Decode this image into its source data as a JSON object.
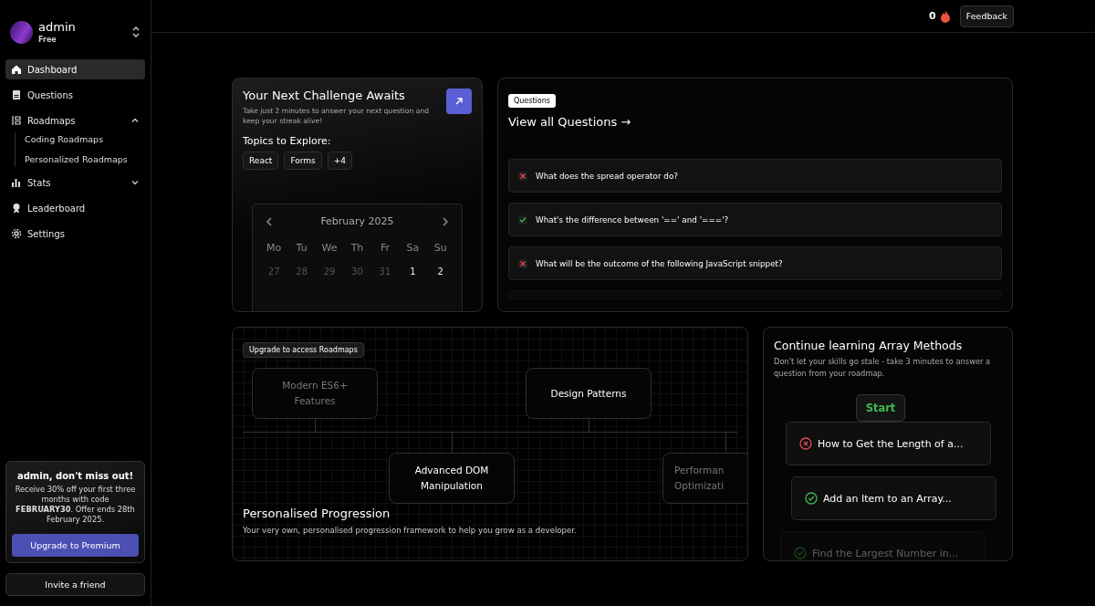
{
  "user": {
    "name": "admin",
    "plan": "Free"
  },
  "sidebar": {
    "items": [
      {
        "label": "Dashboard",
        "selected": true
      },
      {
        "label": "Questions",
        "selected": false
      },
      {
        "label": "Roadmaps",
        "selected": false,
        "expanded": true,
        "children": [
          {
            "label": "Coding Roadmaps",
            "selected": false
          },
          {
            "label": "Personalized Roadmaps",
            "selected": false
          }
        ]
      },
      {
        "label": "Stats",
        "selected": false,
        "expanded": false
      },
      {
        "label": "Leaderboard",
        "selected": false
      },
      {
        "label": "Settings",
        "selected": false
      }
    ]
  },
  "promo": {
    "title": "admin, don't miss out!",
    "text": "Receive 30% off your first three months with code **FEBRUARY30**. Offer ends 28th February 2025.",
    "button": "Upgrade to Premium"
  },
  "invite_button": "Invite a friend",
  "topbar": {
    "streak": "0",
    "feedback": "Feedback"
  },
  "challenge": {
    "title": "Your Next Challenge Awaits",
    "text": "Take just 2 minutes to answer your next question and keep your streak alive!",
    "topics_label": "Topics to Explore:",
    "topics": [
      "React",
      "Forms",
      "+4"
    ],
    "calendar": {
      "month": "February 2025",
      "weekdays": [
        "Mo",
        "Tu",
        "We",
        "Th",
        "Fr",
        "Sa",
        "Su"
      ],
      "days": [
        {
          "label": "27",
          "muted": true
        },
        {
          "label": "28",
          "muted": true
        },
        {
          "label": "29",
          "muted": true
        },
        {
          "label": "30",
          "muted": true
        },
        {
          "label": "31",
          "muted": true
        },
        {
          "label": "1",
          "muted": false
        },
        {
          "label": "2",
          "muted": false
        }
      ]
    }
  },
  "questions": {
    "badge": "Questions",
    "link": "View all Questions →",
    "items": [
      {
        "text": "What does the spread operator do?",
        "correct": false
      },
      {
        "text": "What's the difference between '==' and '==='?",
        "correct": true
      },
      {
        "text": "What will be the outcome of the following JavaScript snippet?",
        "correct": false
      }
    ]
  },
  "roadmap": {
    "badge": "Upgrade to access Roadmaps",
    "nodes": [
      {
        "label": "Modern ES6+ Features",
        "faded": true
      },
      {
        "label": "Advanced DOM Manipulation",
        "faded": false
      },
      {
        "label": "Design Patterns",
        "faded": false
      },
      {
        "label": "Performan Optimizati",
        "faded": true
      }
    ],
    "title": "Personalised Progression",
    "text": "Your very own, personalised progression framework to help you grow as a developer."
  },
  "continue": {
    "title": "Continue learning Array Methods",
    "text": "Don't let your skills go stale - take 3 minutes to answer a question from your roadmap.",
    "start": "Start",
    "items": [
      {
        "text": "How to Get the Length of a...",
        "correct": false,
        "faded": false
      },
      {
        "text": "Add an Item to an Array...",
        "correct": true,
        "faded": false
      },
      {
        "text": "Find the Largest Number in...",
        "correct": true,
        "faded": true
      }
    ]
  }
}
